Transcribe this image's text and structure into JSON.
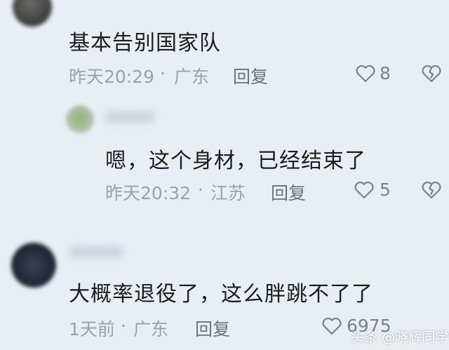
{
  "comments": [
    {
      "text": "基本告别国家队",
      "time": "昨天20:29",
      "separator": "·",
      "location": "广东",
      "reply_label": "回复",
      "likes": "8",
      "level": "top"
    },
    {
      "text": "嗯，这个身材，已经结束了",
      "time": "昨天20:32",
      "separator": "·",
      "location": "江苏",
      "reply_label": "回复",
      "likes": "5",
      "level": "reply"
    },
    {
      "text": "大概率退役了，这么胖跳不了了",
      "time": "1天前",
      "separator": "·",
      "location": "广东",
      "reply_label": "回复",
      "likes": "6975",
      "level": "top"
    }
  ],
  "watermark": {
    "platform": "头条",
    "handle": "@晓辉同学记"
  },
  "icons": {
    "like": "heart-outline-icon",
    "dislike": "broken-heart-icon"
  },
  "colors": {
    "background": "#e8eef6",
    "text": "#1c1c1c",
    "meta": "#9aa3ad",
    "icon": "#7b838c"
  }
}
